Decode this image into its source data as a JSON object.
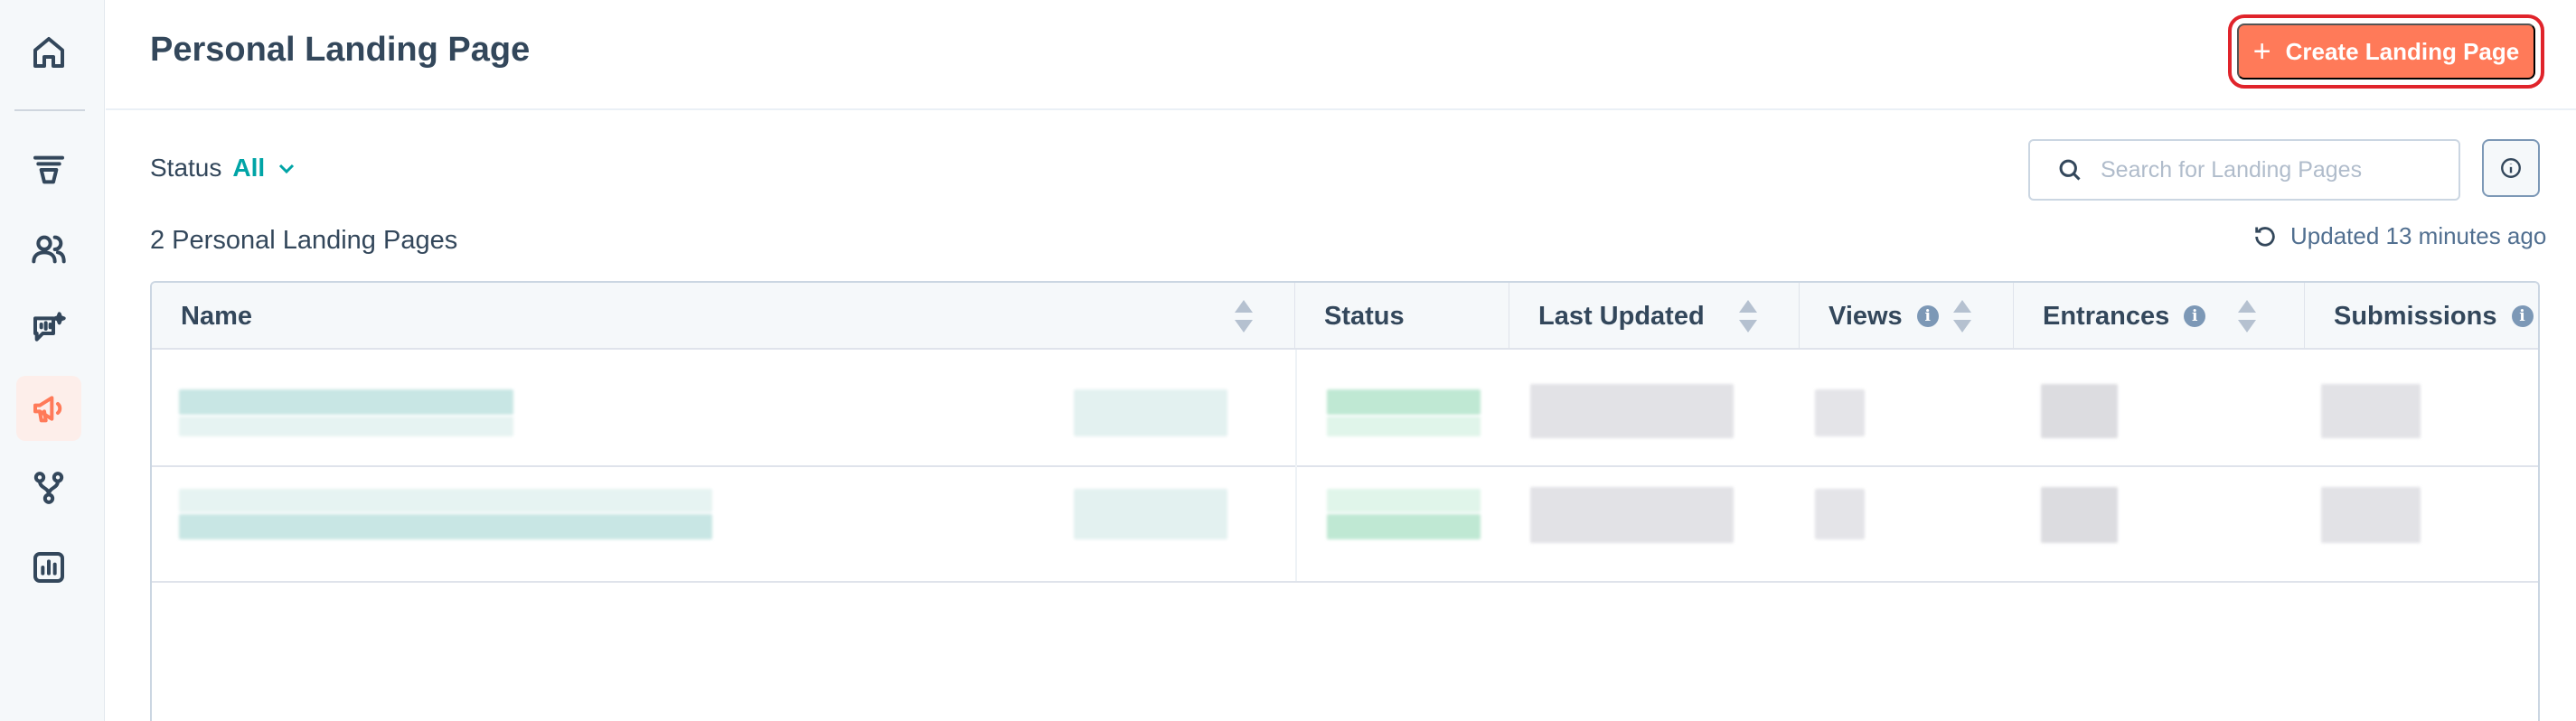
{
  "sidebar": {
    "items": [
      {
        "icon": "home-icon",
        "active": false
      },
      {
        "icon": "funnel-icon",
        "active": false
      },
      {
        "icon": "contacts-icon",
        "active": false
      },
      {
        "icon": "conversations-icon",
        "active": false
      },
      {
        "icon": "marketing-megaphone-icon",
        "active": true
      },
      {
        "icon": "workflows-icon",
        "active": false
      },
      {
        "icon": "reports-icon",
        "active": false
      }
    ]
  },
  "header": {
    "title": "Personal Landing Page",
    "create_button_label": "Create Landing Page"
  },
  "filters": {
    "status_label": "Status",
    "status_value": "All"
  },
  "search": {
    "placeholder": "Search for Landing Pages",
    "value": ""
  },
  "summary": {
    "count_text": "2 Personal Landing Pages",
    "updated_text": "Updated 13 minutes ago"
  },
  "table": {
    "columns": [
      {
        "label": "Name",
        "sortable": true,
        "info": false
      },
      {
        "label": "Status",
        "sortable": false,
        "info": false
      },
      {
        "label": "Last Updated",
        "sortable": true,
        "info": false
      },
      {
        "label": "Views",
        "sortable": true,
        "info": true
      },
      {
        "label": "Entrances",
        "sortable": true,
        "info": true
      },
      {
        "label": "Submissions",
        "sortable": false,
        "info": true
      }
    ],
    "info_glyph": "i"
  },
  "colors": {
    "accent": "#ff7a59",
    "teal": "#00a4a6",
    "text": "#33475b",
    "highlight_border": "#e0242b"
  }
}
